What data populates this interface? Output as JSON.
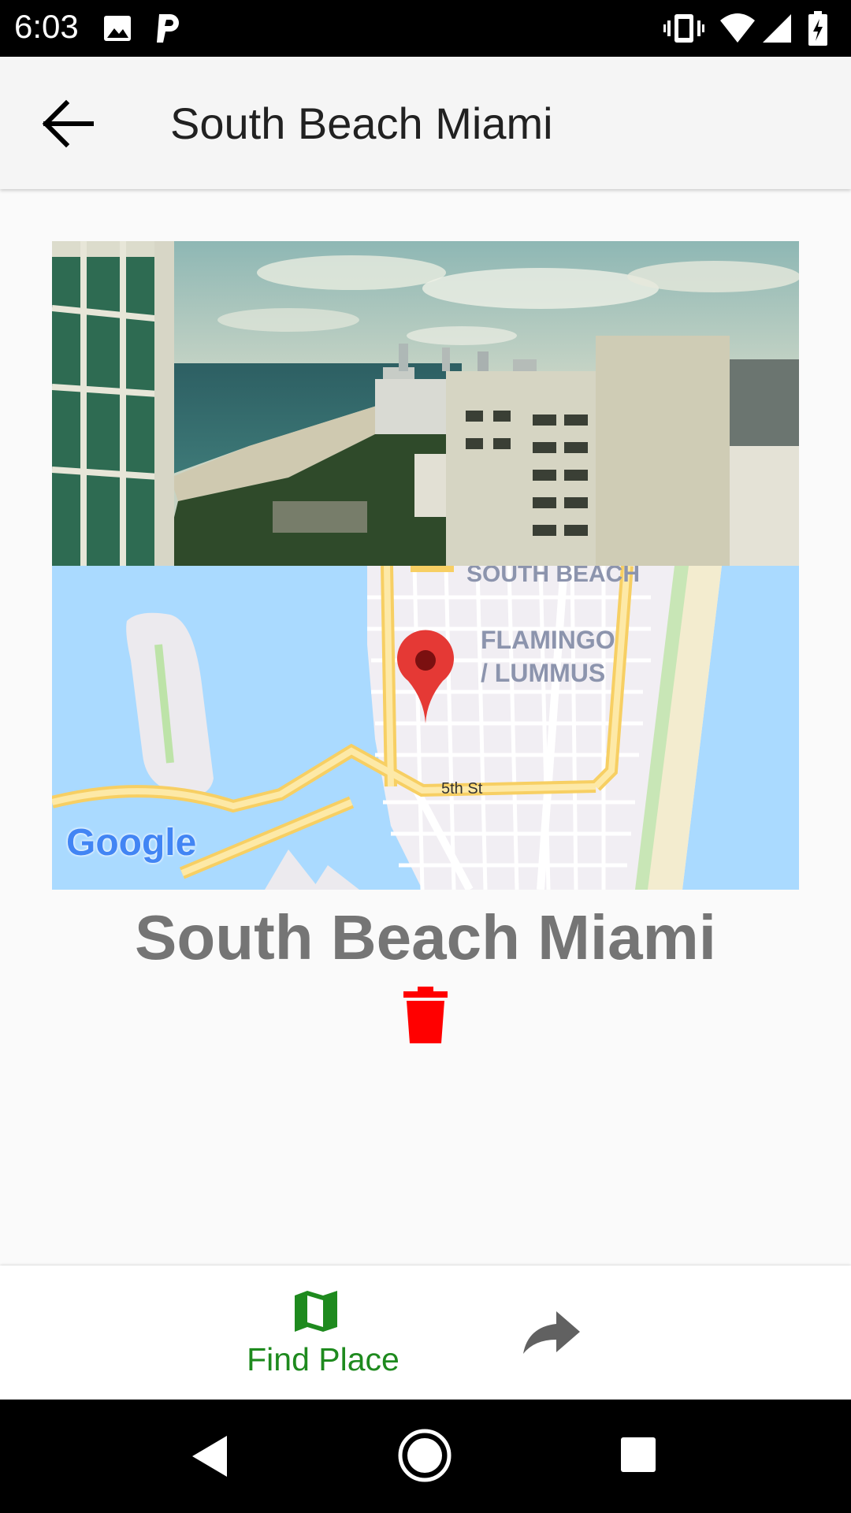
{
  "status_bar": {
    "time": "6:03",
    "icons_left": [
      "image-icon",
      "parking-app-icon"
    ],
    "icons_right": [
      "vibrate-icon",
      "wifi-icon",
      "signal-icon",
      "battery-charging-icon"
    ]
  },
  "app_bar": {
    "back_icon": "arrow-back-icon",
    "title": "South Beach Miami"
  },
  "place": {
    "name": "South Beach Miami",
    "delete_icon": "trash-icon"
  },
  "map": {
    "labels": {
      "neighborhood_1": "SOUTH BEACH",
      "neighborhood_2_line1": "FLAMINGO",
      "neighborhood_2_line2": "/ LUMMUS",
      "street": "5th St"
    },
    "attribution": "Google",
    "marker_icon": "map-pin-icon"
  },
  "bottom_nav": {
    "find_place_label": "Find Place",
    "find_place_icon": "map-icon",
    "share_icon": "share-arrow-icon",
    "accent_color": "#1e8a1e"
  },
  "system_nav": {
    "icons": [
      "back-triangle-icon",
      "home-circle-icon",
      "recents-square-icon"
    ]
  }
}
